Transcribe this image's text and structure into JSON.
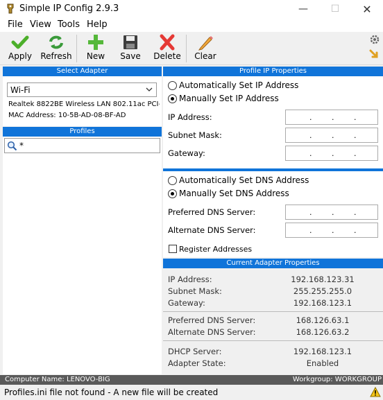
{
  "window": {
    "title": "Simple IP Config 2.9.3"
  },
  "menu": [
    "File",
    "View",
    "Tools",
    "Help"
  ],
  "toolbar": {
    "apply": "Apply",
    "refresh": "Refresh",
    "new": "New",
    "save": "Save",
    "delete": "Delete",
    "clear": "Clear"
  },
  "left": {
    "select_adapter_header": "Select Adapter",
    "adapter_selected": "Wi-Fi",
    "adapter_description": "Realtek 8822BE Wireless LAN 802.11ac PCI-",
    "mac_address": "MAC Address: 10-5B-AD-08-BF-AD",
    "profiles_header": "Profiles",
    "search_value": "*"
  },
  "profile": {
    "header": "Profile IP Properties",
    "auto_ip": "Automatically Set IP Address",
    "manual_ip": "Manually Set IP Address",
    "ip_address": "IP Address:",
    "subnet_mask": "Subnet Mask:",
    "gateway": "Gateway:",
    "auto_dns": "Automatically Set DNS Address",
    "manual_dns": "Manually Set DNS Address",
    "preferred_dns": "Preferred DNS Server:",
    "alternate_dns": "Alternate DNS Server:",
    "register": "Register Addresses"
  },
  "current": {
    "header": "Current Adapter Properties",
    "ip_label": "IP Address:",
    "ip_value": "192.168.123.31",
    "subnet_label": "Subnet Mask:",
    "subnet_value": "255.255.255.0",
    "gateway_label": "Gateway:",
    "gateway_value": "192.168.123.1",
    "pdns_label": "Preferred DNS Server:",
    "pdns_value": "168.126.63.1",
    "adns_label": "Alternate DNS Server:",
    "adns_value": "168.126.63.2",
    "dhcp_label": "DHCP Server:",
    "dhcp_value": "192.168.123.1",
    "state_label": "Adapter State:",
    "state_value": "Enabled"
  },
  "statusbar": {
    "computer_name": "Computer Name: LENOVO-BIG",
    "workgroup": "Workgroup: WORKGROUP",
    "message": "Profiles.ini file not found - A new file will be created"
  },
  "icons": [
    "app-icon",
    "minimize-icon",
    "maximize-icon",
    "close-icon",
    "apply-icon",
    "refresh-icon",
    "new-icon",
    "save-icon",
    "delete-icon",
    "clear-icon",
    "settings-icon",
    "arrow-icon",
    "search-icon",
    "chevron-down-icon",
    "warning-icon"
  ],
  "colors": {
    "header_blue": "#1074d9",
    "apply_green": "#4caf2a",
    "delete_red": "#e53935",
    "status_dark": "#5a5a5a"
  }
}
